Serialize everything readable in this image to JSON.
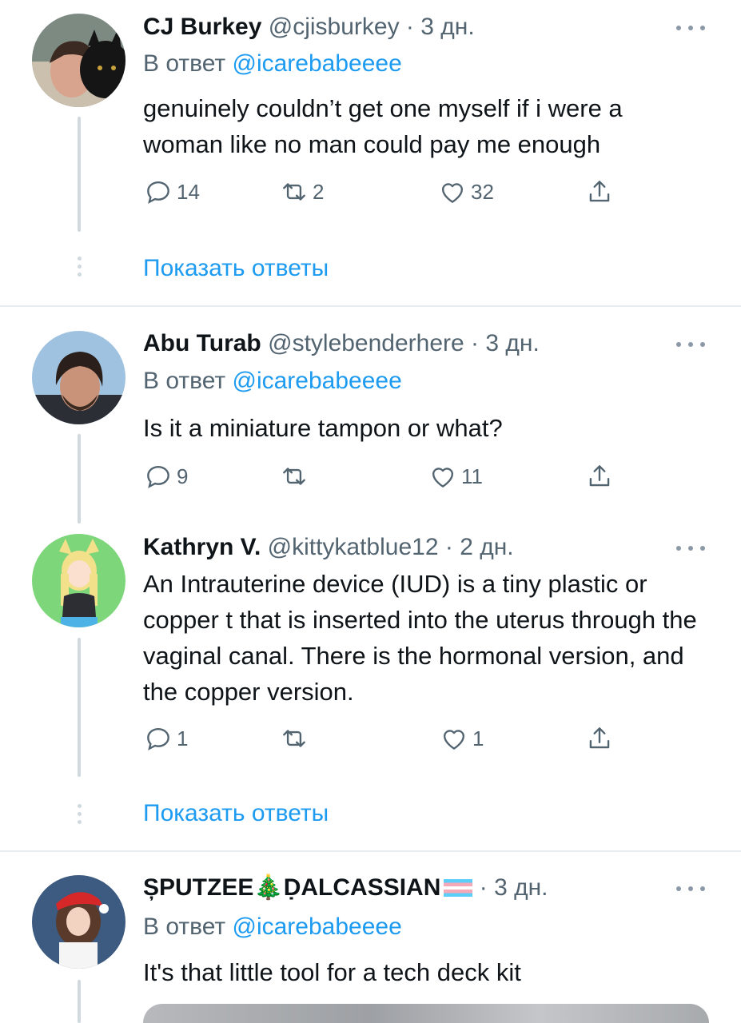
{
  "tweets": [
    {
      "name": "CJ Burkey",
      "handle": "@cjisburkey",
      "sep": " · ",
      "time": "3 дн.",
      "reply_prefix": "В ответ ",
      "reply_mention": "@icarebabeeee",
      "body": "genuinely couldn’t get one myself if i were a woman like no man could pay me enough",
      "replies": "14",
      "retweets": "2",
      "likes": "32"
    },
    {
      "name": "Abu Turab",
      "handle": "@stylebenderhere",
      "sep": " · ",
      "time": "3 дн.",
      "reply_prefix": "В ответ ",
      "reply_mention": "@icarebabeeee",
      "body": "Is it a miniature tampon or what?",
      "replies": "9",
      "retweets": "",
      "likes": "11"
    },
    {
      "name": "Kathryn V.",
      "handle": "@kittykatblue12",
      "sep": " · ",
      "time": "2 дн.",
      "body": "An Intrauterine device (IUD) is a tiny plastic or copper t that is inserted into the uterus through the vaginal canal. There is the hormonal version, and the copper version.",
      "replies": "1",
      "retweets": "",
      "likes": "1"
    },
    {
      "name_part1": "ȘPUTZEE",
      "name_emoji": "🎄",
      "name_part2": "ḌALCASSIAN",
      "sep": " · ",
      "time": "3 дн.",
      "reply_prefix": "В ответ ",
      "reply_mention": "@icarebabeeee",
      "body": "It's that little tool for a tech deck kit"
    }
  ],
  "show_replies_label": "Показать ответы",
  "icons": [
    "reply-icon",
    "retweet-icon",
    "like-icon",
    "share-icon",
    "more-icon",
    "christmas-tree-icon",
    "trans-flag-icon"
  ],
  "colors": {
    "accent": "#1d9bf0",
    "muted": "#536471",
    "text": "#0f1419",
    "line": "#cfd9de"
  }
}
